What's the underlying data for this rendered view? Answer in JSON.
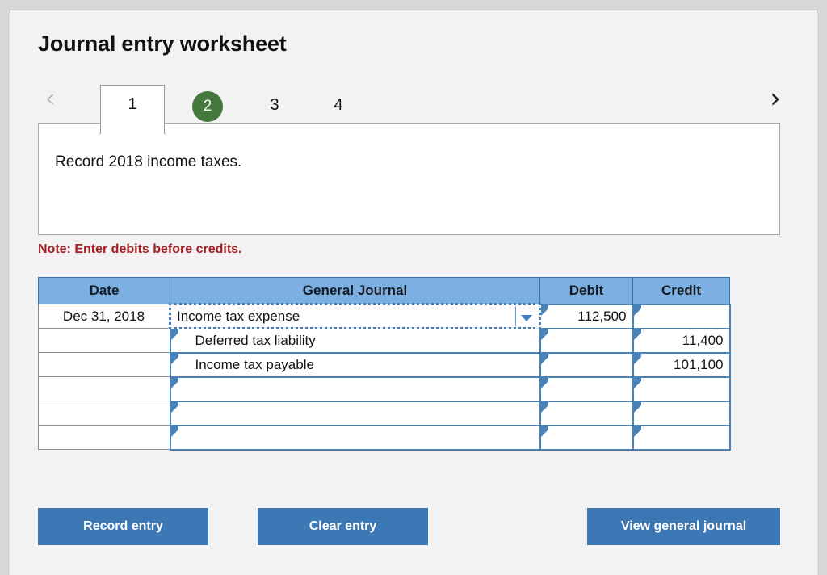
{
  "header": {
    "title": "Journal entry worksheet"
  },
  "tabs": {
    "prev_icon": "chevron-left-icon",
    "prev_glyph": "‹",
    "next_icon": "chevron-right-icon",
    "next_glyph": "›",
    "items": [
      {
        "label": "1",
        "state": "active"
      },
      {
        "label": "2",
        "state": "badge"
      },
      {
        "label": "3",
        "state": "plain"
      },
      {
        "label": "4",
        "state": "plain"
      }
    ],
    "badge_color": "#44783c"
  },
  "description": {
    "text": "Record 2018 income taxes."
  },
  "note": {
    "text": "Note: Enter debits before credits.",
    "color": "#a61f23"
  },
  "table": {
    "header_color": "#7db0e2",
    "columns": [
      "Date",
      "General Journal",
      "Debit",
      "Credit"
    ],
    "rows": [
      {
        "date": "Dec 31, 2018",
        "account": "Income tax expense",
        "account_selected": true,
        "account_indent": false,
        "debit": "112,500",
        "credit": ""
      },
      {
        "date": "",
        "account": "Deferred tax liability",
        "account_selected": false,
        "account_indent": true,
        "debit": "",
        "credit": "11,400"
      },
      {
        "date": "",
        "account": "Income tax payable",
        "account_selected": false,
        "account_indent": true,
        "debit": "",
        "credit": "101,100"
      },
      {
        "date": "",
        "account": "",
        "account_selected": false,
        "account_indent": true,
        "debit": "",
        "credit": ""
      },
      {
        "date": "",
        "account": "",
        "account_selected": false,
        "account_indent": true,
        "debit": "",
        "credit": ""
      },
      {
        "date": "",
        "account": "",
        "account_selected": false,
        "account_indent": true,
        "debit": "",
        "credit": ""
      }
    ]
  },
  "actions": {
    "record_entry": "Record entry",
    "clear_entry": "Clear entry",
    "view_general_journal": "View general journal",
    "button_color": "#3b78b5"
  }
}
